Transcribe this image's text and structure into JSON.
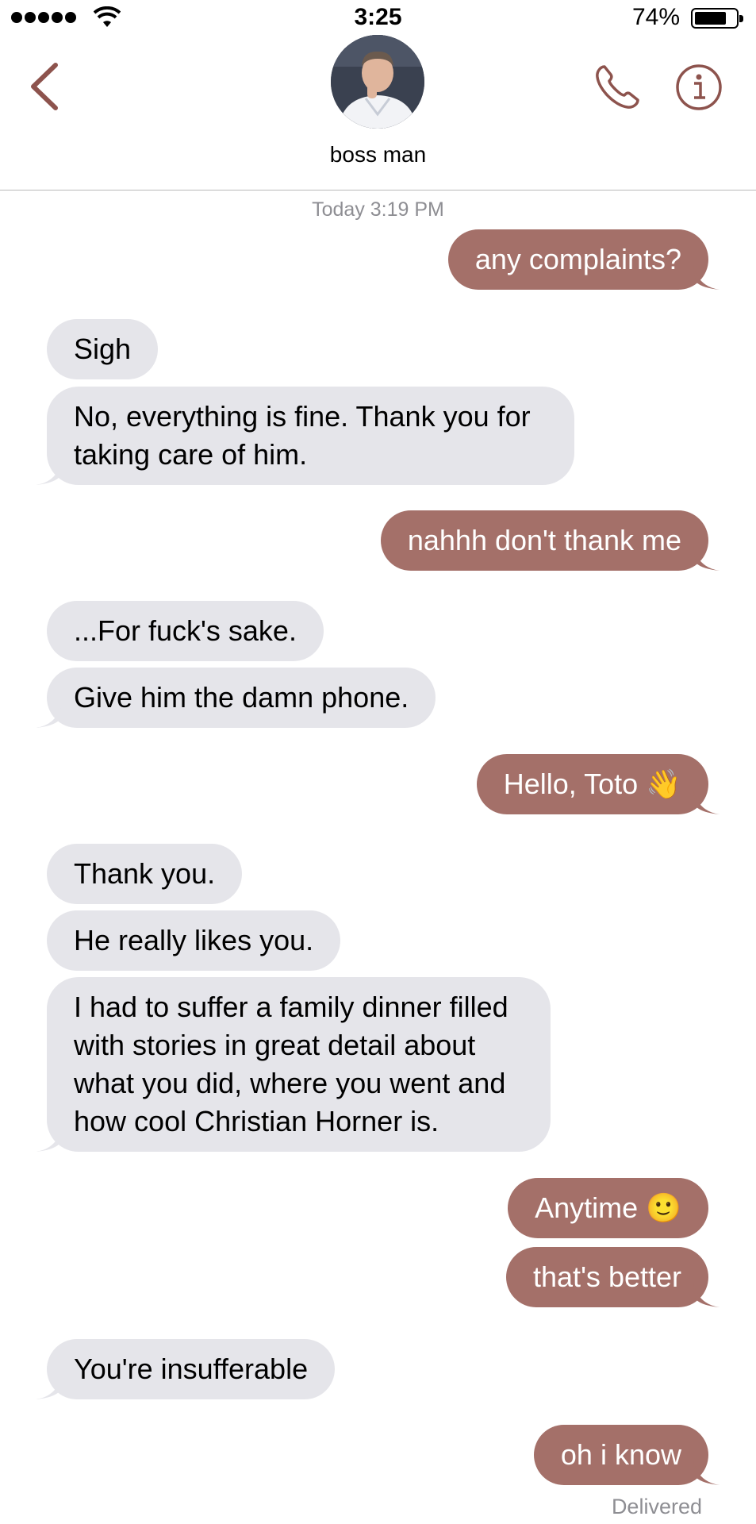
{
  "status_bar": {
    "time": "3:25",
    "battery_percent": "74%",
    "battery_level": 0.74,
    "signal_bars": 5
  },
  "nav": {
    "contact_name": "boss man",
    "back_icon": "chevron-left-icon",
    "call_icon": "phone-icon",
    "info_icon": "info-icon"
  },
  "thread": {
    "timestamp": "Today 3:19 PM",
    "delivered_label": "Delivered",
    "messages": [
      {
        "from": "me",
        "text": "any complaints?"
      },
      {
        "from": "them",
        "text": "Sigh"
      },
      {
        "from": "them",
        "text": "No, everything is fine. Thank you for taking care of him."
      },
      {
        "from": "me",
        "text": "nahhh don't thank me"
      },
      {
        "from": "them",
        "text": "...For fuck's sake."
      },
      {
        "from": "them",
        "text": "Give him the damn phone."
      },
      {
        "from": "me",
        "text": "Hello, Toto 👋"
      },
      {
        "from": "them",
        "text": "Thank you."
      },
      {
        "from": "them",
        "text": "He really likes you."
      },
      {
        "from": "them",
        "text": "I had to suffer a family dinner filled with stories in great detail about what you did, where you went and how cool Christian Horner is."
      },
      {
        "from": "me",
        "text": "Anytime 🙂"
      },
      {
        "from": "me",
        "text": "that's better"
      },
      {
        "from": "them",
        "text": "You're insufferable"
      },
      {
        "from": "me",
        "text": "oh i know"
      }
    ]
  },
  "colors": {
    "accent": "#8d534d",
    "sent_bubble": "#a47069",
    "received_bubble": "#e5e5ea"
  }
}
